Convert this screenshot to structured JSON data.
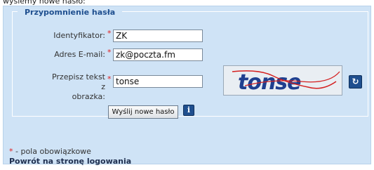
{
  "intro": "wyślemy nowe hasło:",
  "legend": "Przypomnienie hasła",
  "form": {
    "id_label": "Identyfikator:",
    "id_value": "ZK",
    "email_label": "Adres E-mail:",
    "email_value": "zk@poczta.fm",
    "captcha_label_line1": "Przepisz tekst z",
    "captcha_label_line2": "obrazka:",
    "captcha_value": "tonse",
    "required_mark": "*"
  },
  "captcha_image": {
    "text": "tonse"
  },
  "refresh_icon_glyph": "↻",
  "submit_label": "Wyślij nowe hasło",
  "info_icon_glyph": "i",
  "footer": {
    "required_mark": "*",
    "required_note": " - pola obowiązkowe",
    "back_link": "Powrót na stronę logowania"
  },
  "colors": {
    "panel_bg": "#cfe3f6",
    "legend_text": "#1f4f8f",
    "required": "#e02020",
    "captcha_text": "#1f3f8f",
    "captcha_line": "#d42020"
  }
}
